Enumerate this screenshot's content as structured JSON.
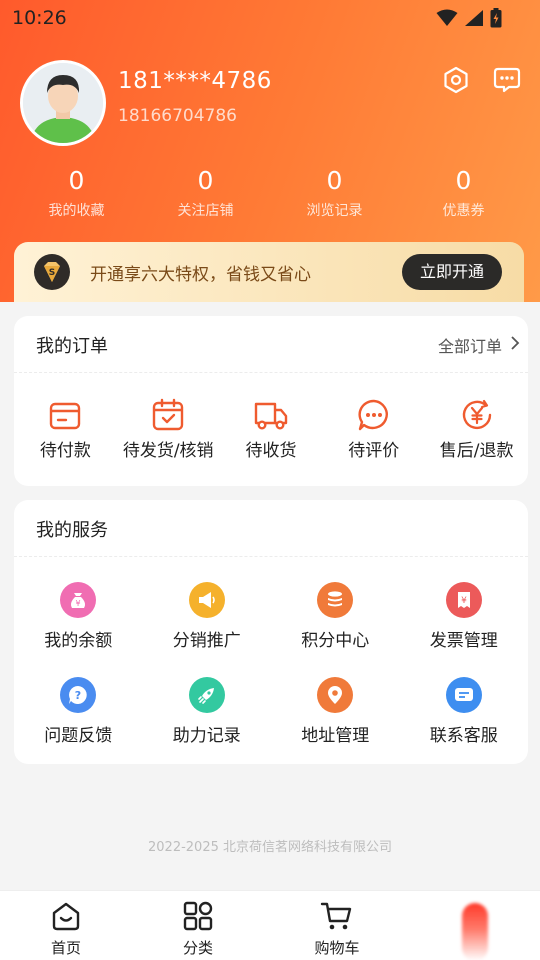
{
  "status_bar": {
    "time": "10:26"
  },
  "profile": {
    "phone_masked": "181****4786",
    "phone_full": "18166704786"
  },
  "stats": [
    {
      "value": "0",
      "label": "我的收藏"
    },
    {
      "value": "0",
      "label": "关注店铺"
    },
    {
      "value": "0",
      "label": "浏览记录"
    },
    {
      "value": "0",
      "label": "优惠券"
    }
  ],
  "vip": {
    "badge": "S",
    "text": "开通享六大特权，省钱又省心",
    "button": "立即开通"
  },
  "orders": {
    "title": "我的订单",
    "all_link": "全部订单",
    "items": [
      {
        "label": "待付款",
        "icon": "wallet-icon"
      },
      {
        "label": "待发货/核销",
        "icon": "calendar-check-icon"
      },
      {
        "label": "待收货",
        "icon": "truck-icon"
      },
      {
        "label": "待评价",
        "icon": "chat-dots-icon"
      },
      {
        "label": "售后/退款",
        "icon": "yen-refund-icon"
      }
    ]
  },
  "services": {
    "title": "我的服务",
    "items": [
      {
        "label": "我的余额",
        "icon": "money-bag-icon",
        "color": "#f06db2"
      },
      {
        "label": "分销推广",
        "icon": "megaphone-icon",
        "color": "#f5b12c"
      },
      {
        "label": "积分中心",
        "icon": "coins-icon",
        "color": "#f07a3a"
      },
      {
        "label": "发票管理",
        "icon": "invoice-icon",
        "color": "#ec5a5a"
      },
      {
        "label": "问题反馈",
        "icon": "question-icon",
        "color": "#4a8cf0"
      },
      {
        "label": "助力记录",
        "icon": "rocket-icon",
        "color": "#33c9a0"
      },
      {
        "label": "地址管理",
        "icon": "location-pin-icon",
        "color": "#f07a3a"
      },
      {
        "label": "联系客服",
        "icon": "chat-card-icon",
        "color": "#3e8ef0"
      }
    ]
  },
  "footer": {
    "copyright": "2022-2025 北京荷信茗网络科技有限公司"
  },
  "tabbar": [
    {
      "label": "首页",
      "icon": "home-icon"
    },
    {
      "label": "分类",
      "icon": "category-icon"
    },
    {
      "label": "购物车",
      "icon": "cart-icon"
    }
  ],
  "colors": {
    "accent": "#ff6a2f",
    "icon_orange": "#ef5b2f"
  }
}
